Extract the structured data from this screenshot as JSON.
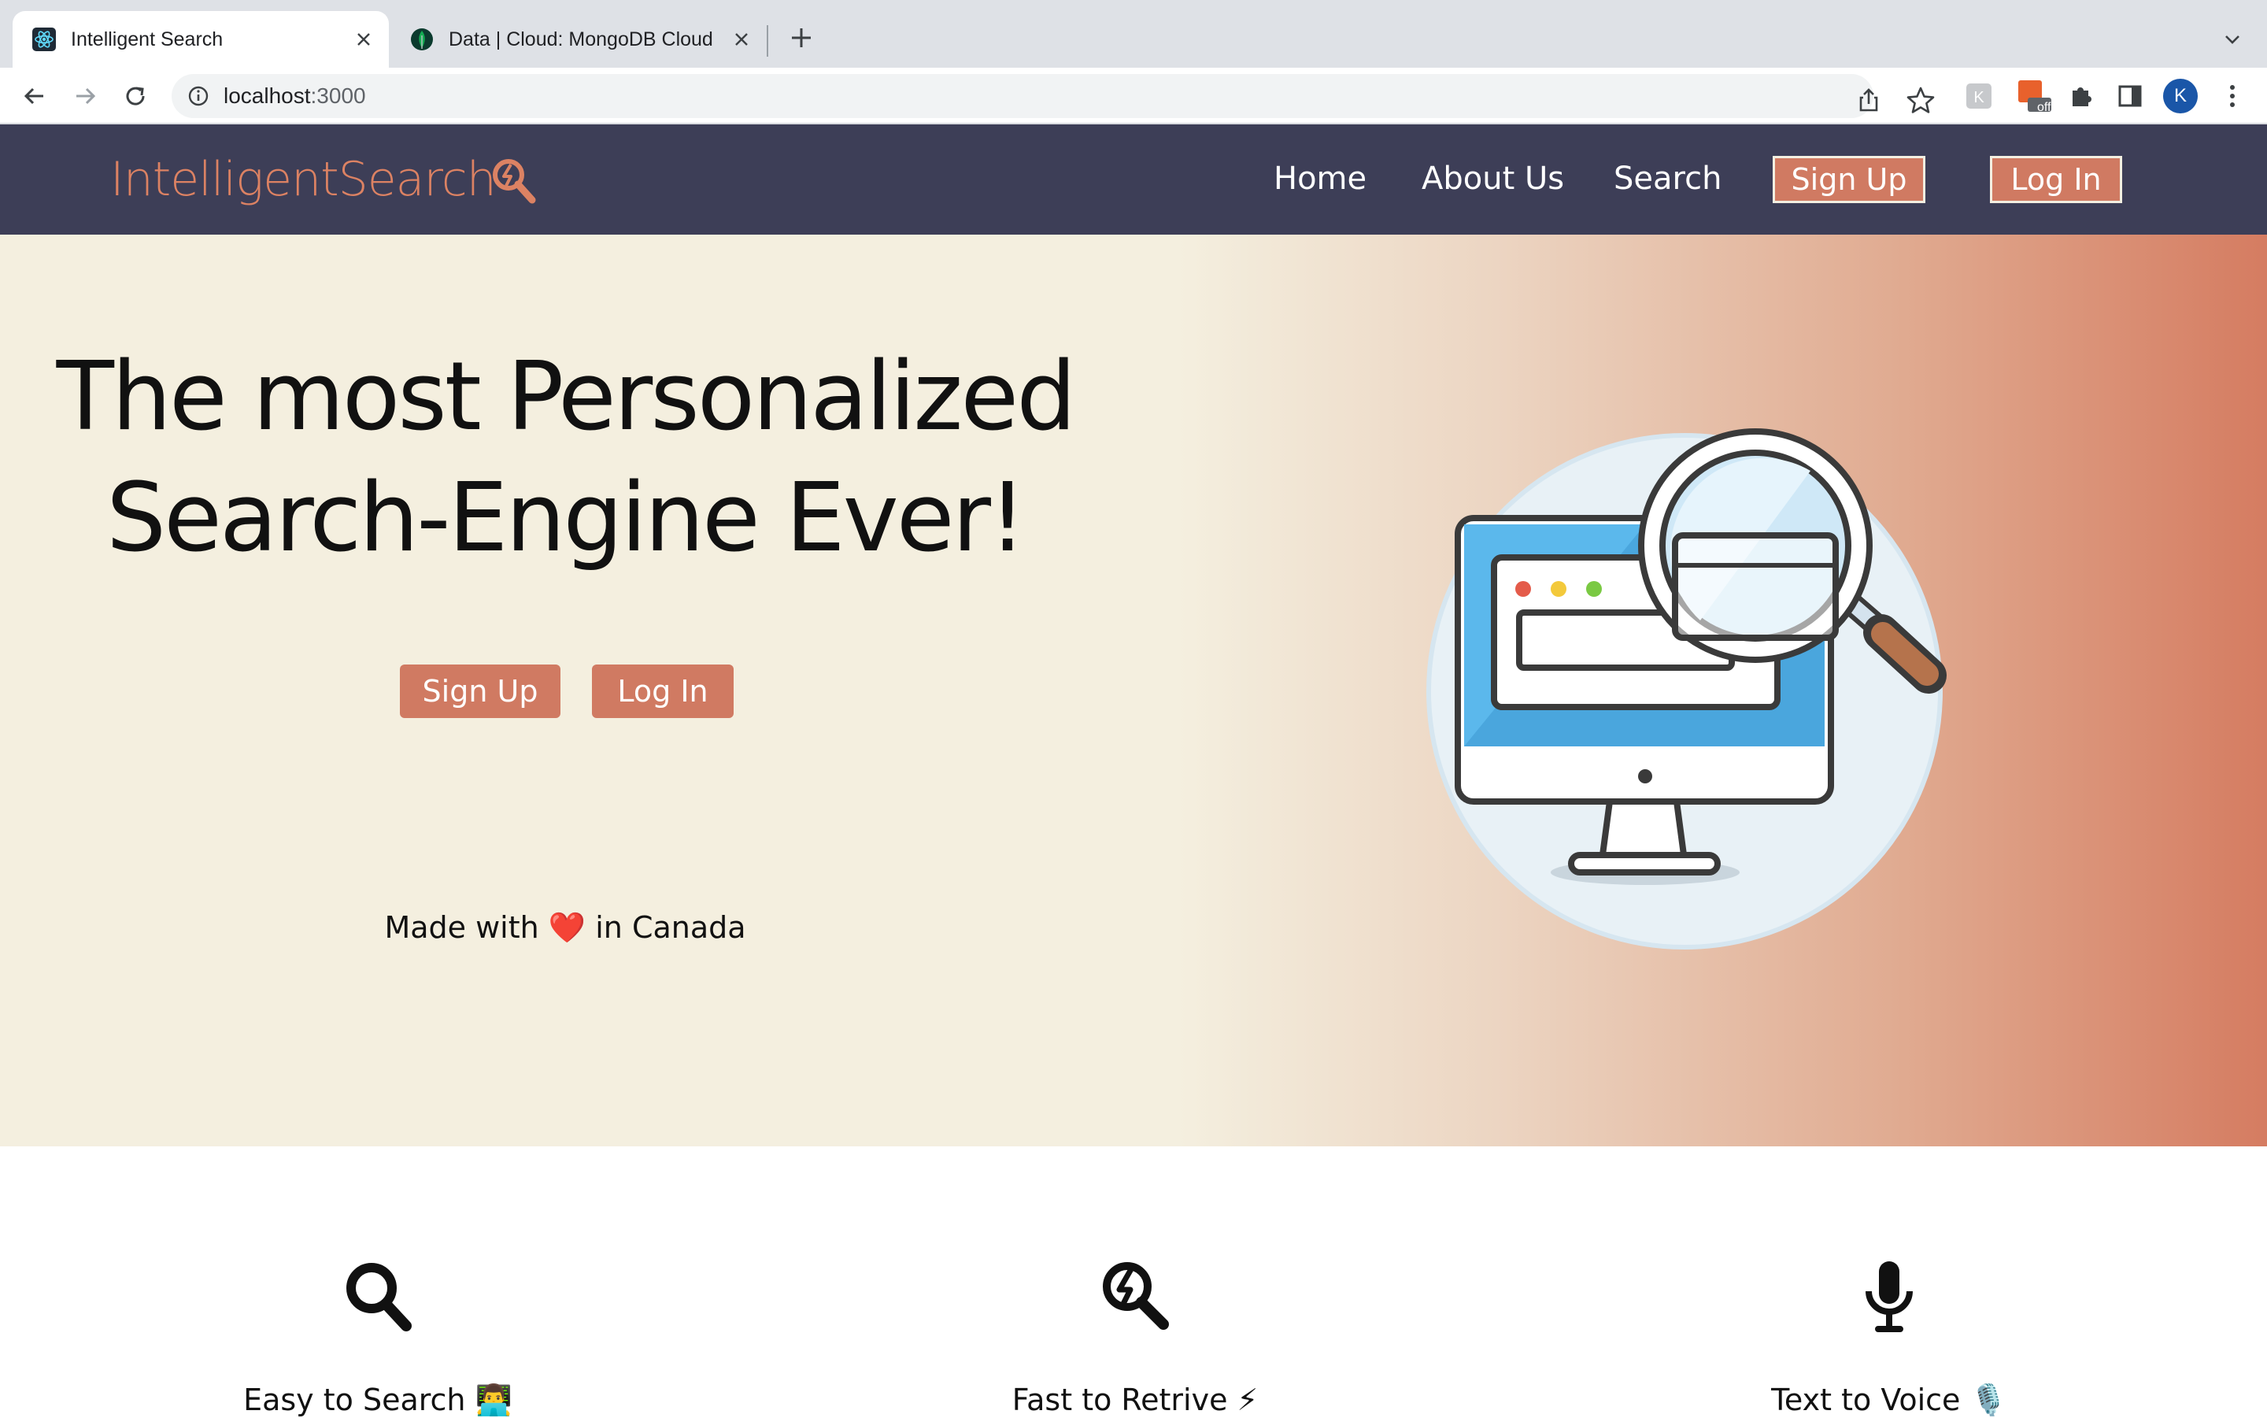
{
  "browser": {
    "tabs": [
      {
        "title": "Intelligent Search",
        "active": true,
        "favicon": "react-icon"
      },
      {
        "title": "Data | Cloud: MongoDB Cloud",
        "active": false,
        "favicon": "mongodb-leaf-icon"
      }
    ],
    "address": {
      "host": "localhost",
      "port": ":3000"
    },
    "profile_initial": "K",
    "extension_badge": "off"
  },
  "site": {
    "brand": "IntelligentSearch",
    "nav": {
      "home": "Home",
      "about": "About Us",
      "search": "Search",
      "signup": "Sign Up",
      "login": "Log In"
    },
    "hero": {
      "title_line1": "The most Personalized",
      "title_line2": "Search-Engine Ever!",
      "signup": "Sign Up",
      "login": "Log In",
      "made_with_prefix": "Made with",
      "made_with_heart": "❤️",
      "made_with_suffix": "in Canada"
    },
    "features": [
      {
        "label": "Easy to Search 👨‍💻",
        "icon": "search-icon"
      },
      {
        "label": "Fast to Retrive ⚡",
        "icon": "fast-search-icon"
      },
      {
        "label": "Text to Voice 🎙️",
        "icon": "microphone-icon"
      }
    ]
  },
  "colors": {
    "navbar_bg": "#3d3e57",
    "accent": "#d07a62",
    "hero_bg": "#f4efdf",
    "brand_text": "#dc8263"
  }
}
